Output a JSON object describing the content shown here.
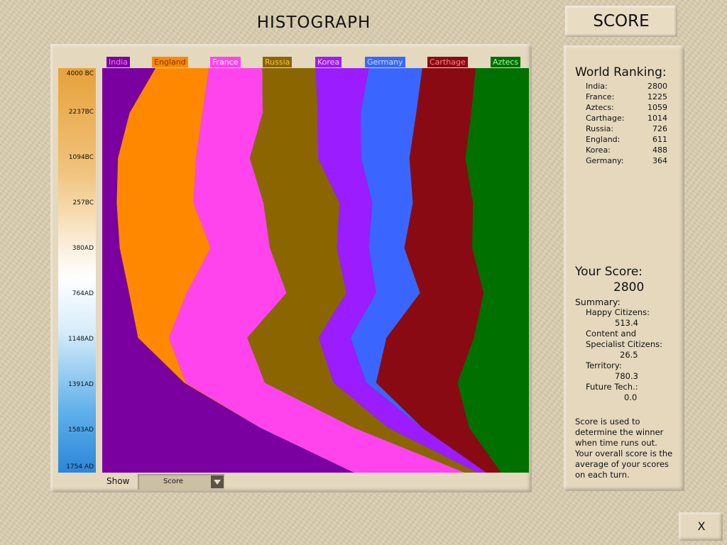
{
  "header": {
    "title": "HISTOGRAPH",
    "score_tab": "SCORE"
  },
  "timeline": {
    "ticks": [
      "4000 BC",
      "2237BC",
      "1094BC",
      "257BC",
      "380AD",
      "764AD",
      "1148AD",
      "1391AD",
      "1583AD",
      "1754 AD"
    ]
  },
  "chart_data": {
    "type": "area",
    "stacked": true,
    "orientation": "vertical-time",
    "x": [
      "4000 BC",
      "2237BC",
      "1094BC",
      "257BC",
      "380AD",
      "764AD",
      "1148AD",
      "1391AD",
      "1583AD",
      "1754 AD"
    ],
    "series": [
      {
        "name": "India",
        "color": "#7a00a0",
        "values": [
          12.5,
          6.4,
          3.7,
          3.4,
          4.1,
          6.3,
          8.4,
          19.2,
          37.0,
          59.0
        ]
      },
      {
        "name": "England",
        "color": "#ff8800",
        "values": [
          12.5,
          17.1,
          18.3,
          18.0,
          21.3,
          13.5,
          7.2,
          0.4,
          0.0,
          0.0
        ]
      },
      {
        "name": "France",
        "color": "#ff44ee",
        "values": [
          12.5,
          14.1,
          12.6,
          16.4,
          13.9,
          23.4,
          18.4,
          18.5,
          22.0,
          26.0
        ]
      },
      {
        "name": "Russia",
        "color": "#8b6500",
        "values": [
          12.5,
          12.9,
          16.0,
          17.8,
          15.7,
          14.0,
          16.7,
          16.1,
          8.0,
          3.0
        ]
      },
      {
        "name": "Korea",
        "color": "#9a1cff",
        "values": [
          12.5,
          10.1,
          10.1,
          7.7,
          7.5,
          7.0,
          7.5,
          7.7,
          8.0,
          2.0
        ]
      },
      {
        "name": "Germany",
        "color": "#3a66ff",
        "values": [
          12.5,
          13.0,
          11.3,
          9.5,
          8.3,
          10.3,
          8.4,
          2.3,
          0.0,
          0.0
        ]
      },
      {
        "name": "Carthage",
        "color": "#8a0a14",
        "values": [
          12.5,
          12.9,
          13.1,
          14.1,
          15.9,
          14.9,
          20.5,
          19.1,
          11.0,
          3.5
        ]
      },
      {
        "name": "Aztecs",
        "color": "#007000",
        "values": [
          12.5,
          13.5,
          14.9,
          13.1,
          13.3,
          10.6,
          12.9,
          16.7,
          14.0,
          6.5
        ]
      }
    ]
  },
  "legend_colors": {
    "India": {
      "bg": "#7a00a0",
      "fg": "#ff77ff"
    },
    "England": {
      "bg": "#ff8800",
      "fg": "#7a3300"
    },
    "France": {
      "bg": "#ff44ee",
      "fg": "#ffeeff"
    },
    "Russia": {
      "bg": "#8b6500",
      "fg": "#f0c050"
    },
    "Korea": {
      "bg": "#9a1cff",
      "fg": "#eec8ff"
    },
    "Germany": {
      "bg": "#3a66ff",
      "fg": "#bfe0ff"
    },
    "Carthage": {
      "bg": "#8a0a14",
      "fg": "#ff8080"
    },
    "Aztecs": {
      "bg": "#007000",
      "fg": "#9cffa0"
    }
  },
  "controls": {
    "show_label": "Show",
    "show_selected": "Score"
  },
  "world_ranking": {
    "title": "World Ranking:",
    "rows": [
      {
        "name": "India:",
        "score": "2800"
      },
      {
        "name": "France:",
        "score": "1225"
      },
      {
        "name": "Aztecs:",
        "score": "1059"
      },
      {
        "name": "Carthage:",
        "score": "1014"
      },
      {
        "name": "Russia:",
        "score": "726"
      },
      {
        "name": "England:",
        "score": "611"
      },
      {
        "name": "Korea:",
        "score": "488"
      },
      {
        "name": "Germany:",
        "score": "364"
      }
    ]
  },
  "your_score": {
    "title": "Your Score:",
    "value": "2800",
    "summary_label": "Summary:",
    "happy_label": "Happy Citizens:",
    "happy_value": "513.4",
    "content_label_1": "Content and",
    "content_label_2": "Specialist Citizens:",
    "content_value": "26.5",
    "territory_label": "Territory:",
    "territory_value": "780.3",
    "future_label": "Future Tech.:",
    "future_value": "0.0"
  },
  "note": {
    "lines": [
      "Score is used to",
      "determine the winner",
      "when time runs out.",
      "Your overall score is the",
      "average of your scores",
      "on each turn."
    ]
  },
  "close_button": {
    "label": "X"
  }
}
